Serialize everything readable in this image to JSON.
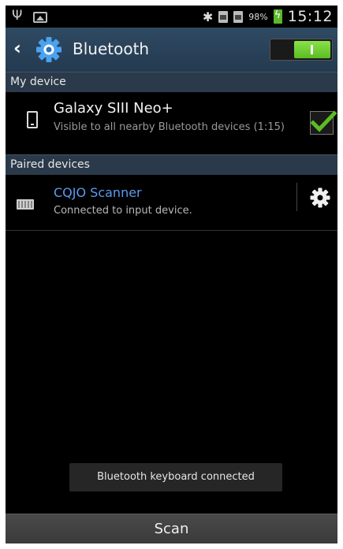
{
  "status_bar": {
    "icons_left": [
      "usb-icon",
      "gallery-icon"
    ],
    "icons_right": [
      "bluetooth-icon",
      "sim1-icon",
      "sim2-icon",
      "battery-charging-icon"
    ],
    "battery_percent": "98%",
    "time": "15:12"
  },
  "action_bar": {
    "title": "Bluetooth",
    "back_icon": "chevron-left-icon",
    "settings_icon": "gear-icon",
    "bluetooth_enabled": true
  },
  "my_device": {
    "header": "My device",
    "name": "Galaxy SIII Neo+",
    "subtitle": "Visible to all nearby Bluetooth devices (1:15)",
    "visible_checked": true,
    "icon": "phone-icon"
  },
  "paired_devices": {
    "header": "Paired devices",
    "items": [
      {
        "name": "CQJO Scanner",
        "status": "Connected to input device.",
        "icon": "keyboard-icon",
        "settings_icon": "gear-icon"
      }
    ]
  },
  "toast": {
    "message": "Bluetooth keyboard connected"
  },
  "bottom_bar": {
    "scan_label": "Scan"
  },
  "colors": {
    "action_bar": "#2f4a63",
    "section_header": "#2b3a4a",
    "accent_green": "#5bbd23",
    "paired_name": "#5b9bf0",
    "gear_blue": "#4aa3f0",
    "background": "#000000"
  }
}
